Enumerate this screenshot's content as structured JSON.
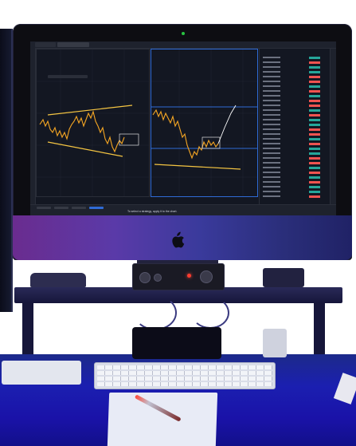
{
  "screen": {
    "status_message": "To select a strategy, apply it to the chart.",
    "colors": {
      "background": "#131722",
      "candle_up": "#f5a623",
      "candle_down": "#ffffff",
      "trend_line": "#f5c542",
      "level_line": "#2f6bd6",
      "watch_green": "#26a69a",
      "watch_red": "#ef5350"
    }
  },
  "scene": {
    "led_color": "#ff3b2f",
    "camera_color": "#29c441",
    "chin_gradient": [
      "#6a2c8f",
      "#3a3a9c",
      "#202266"
    ],
    "desk_color": "#1b1fb0"
  },
  "icons": [
    "apple-logo-icon"
  ]
}
